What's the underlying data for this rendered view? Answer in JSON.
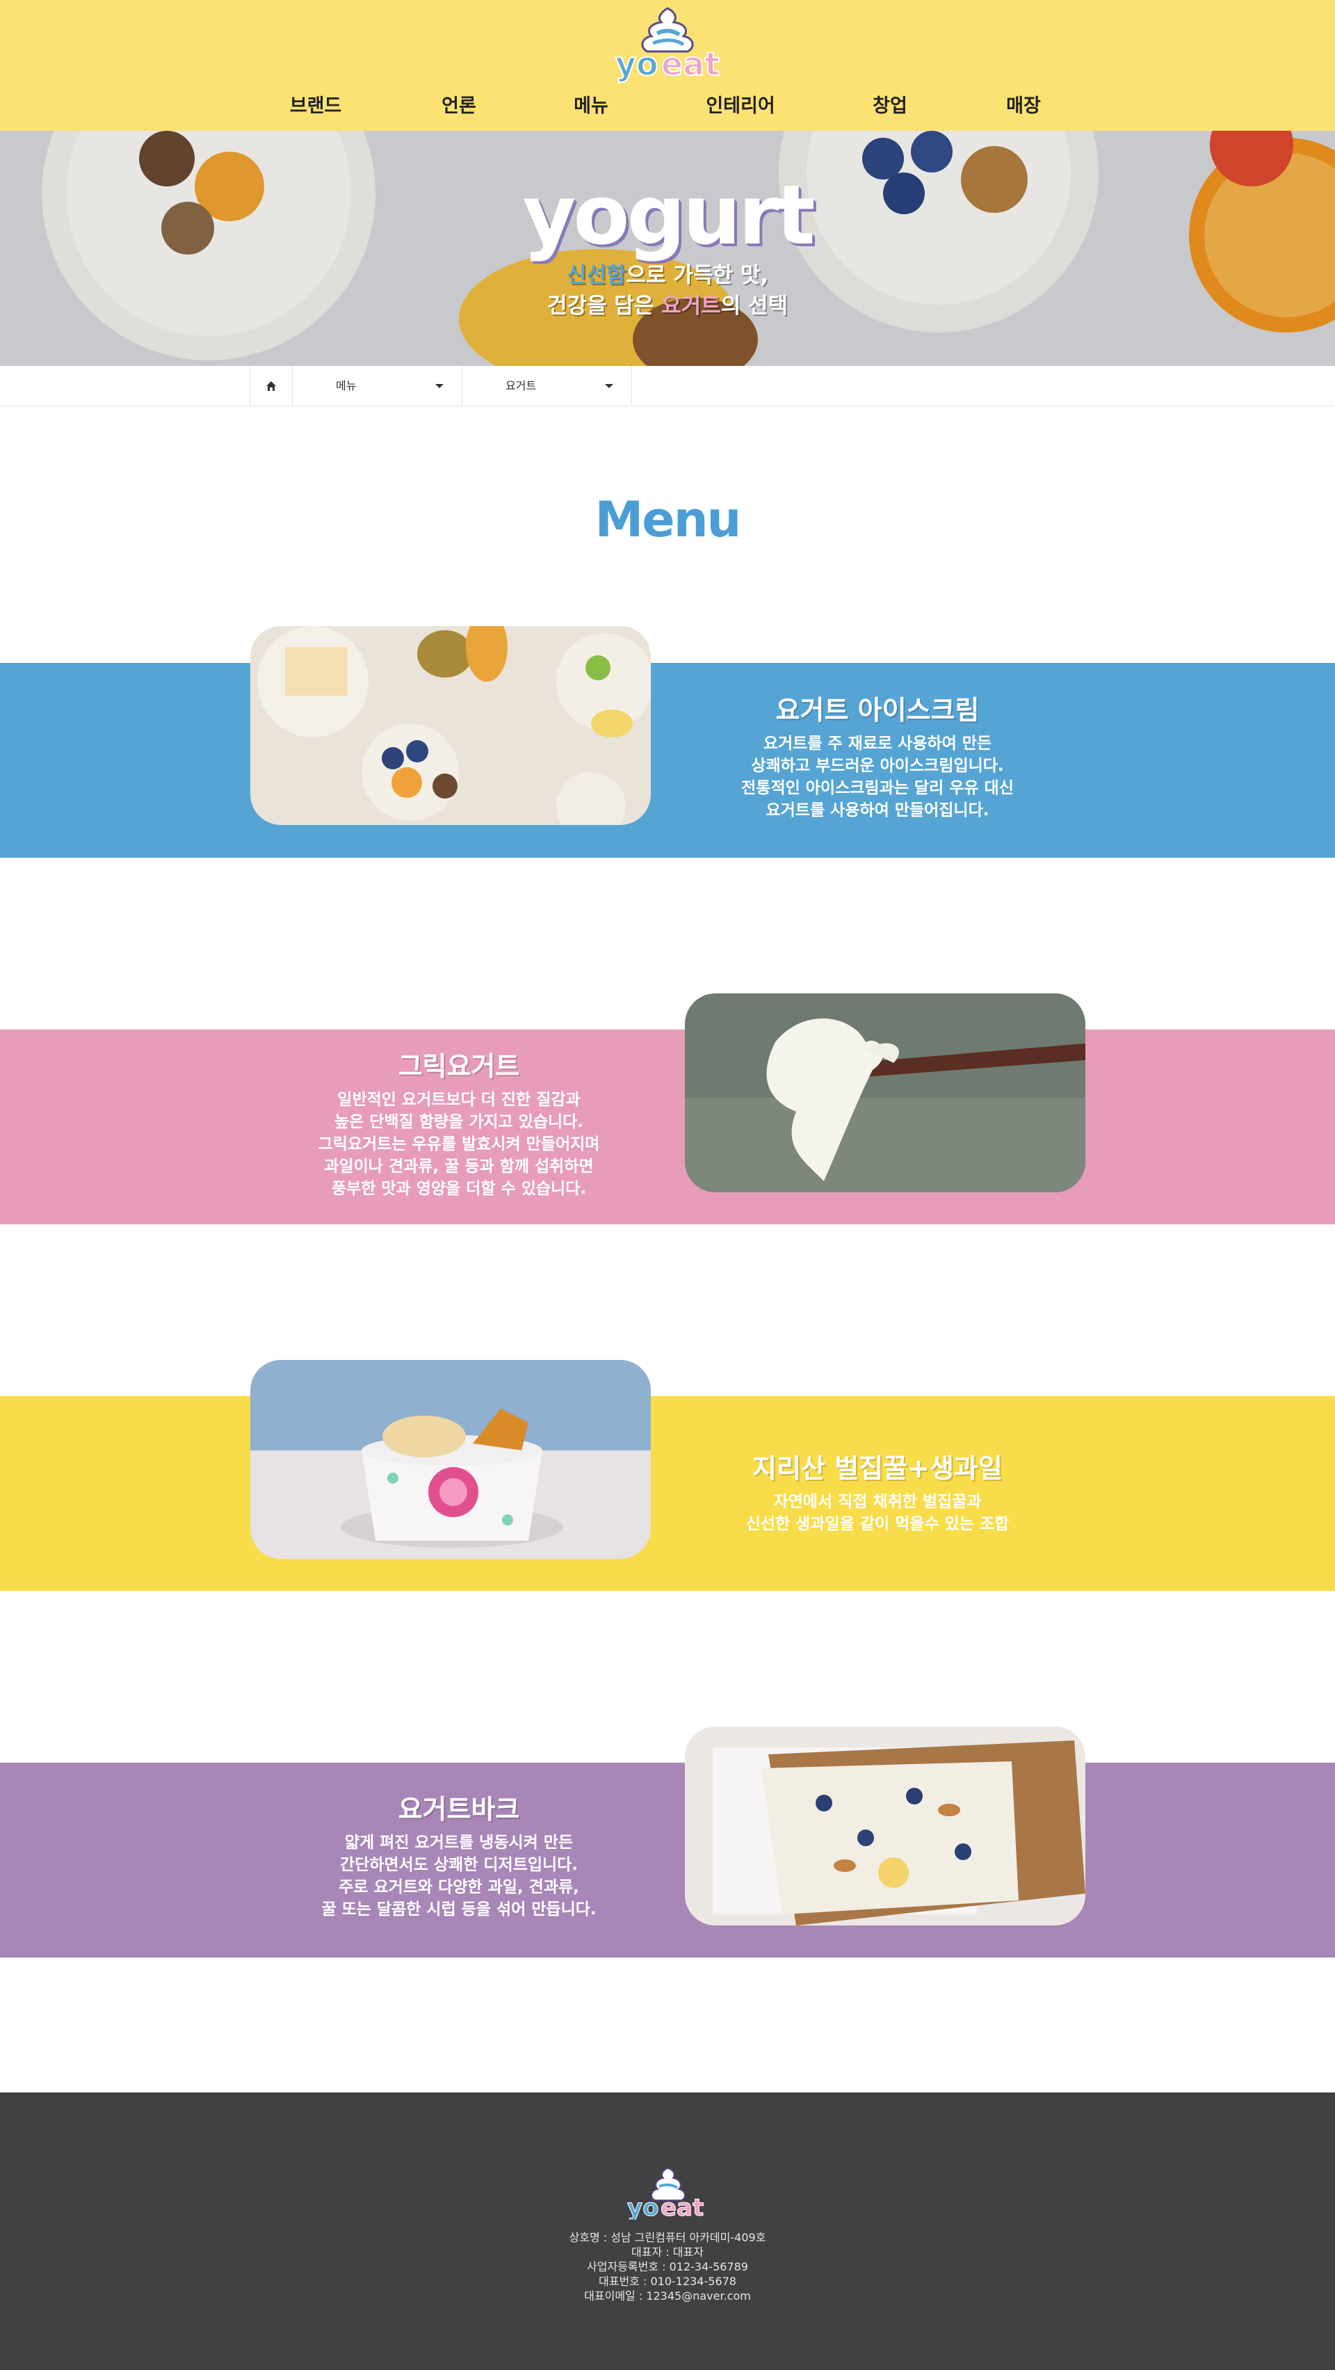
{
  "brand": {
    "logo_text": "yoeat",
    "accent": "#58a6d6",
    "pink": "#f0a3c5",
    "header_bg": "#fbe273"
  },
  "nav": {
    "items": [
      "브랜드",
      "언론",
      "메뉴",
      "인테리어",
      "창업",
      "매장"
    ]
  },
  "hero": {
    "title": "yogurt",
    "line1_hl": "신선함",
    "line1_rest": "으로 가득한 맛,",
    "line2_a": "건강을 담은 ",
    "line2_hl": "요거트",
    "line2_b": "의 선택"
  },
  "breadcrumb": {
    "home_icon": "home-icon",
    "select1": "메뉴",
    "select2": "요거트"
  },
  "section_title": "Menu",
  "menu_items": [
    {
      "title": "요거트 아이스크림",
      "desc": [
        "요거트를 주 재료로 사용하여 만든",
        "상쾌하고 부드러운 아이스크림입니다.",
        "전통적인 아이스크림과는 달리 우유 대신",
        "요거트를 사용하여 만들어집니다."
      ],
      "color": "#55a4d4"
    },
    {
      "title": "그릭요거트",
      "desc": [
        "일반적인 요거트보다 더 진한 질감과",
        "높은 단백질 함량을 가지고 있습니다.",
        "그릭요거트는 우유를 발효시켜 만들어지며",
        "과일이나 견과류, 꿀 등과 함께 섭취하면",
        "풍부한 맛과 영양을 더할 수 있습니다."
      ],
      "color": "#e79cb9"
    },
    {
      "title": "지리산 벌집꿀+생과일",
      "desc": [
        "자연에서 직접 채취한 벌집꿀과",
        "신선한 생과일을 같이 먹을수 있는 조합"
      ],
      "color": "#f8dc4a"
    },
    {
      "title": "요거트바크",
      "desc": [
        "얇게 펴진 요거트를 냉동시켜 만든",
        "간단하면서도 상쾌한 디저트입니다.",
        "주로 요거트와 다양한 과일, 견과류,",
        "꿀 또는 달콤한 시럽 등을 섞어 만듭니다."
      ],
      "color": "#a886b8"
    }
  ],
  "footer": {
    "logo_text": "yoeat",
    "lines": [
      "상호명 : 성남 그린컴퓨터 아카데미-409호",
      "대표자 : 대표자",
      "사업자등록번호 : 012-34-56789",
      "대표번호 : 010-1234-5678",
      "대표이메일 : 12345@naver.com"
    ]
  }
}
